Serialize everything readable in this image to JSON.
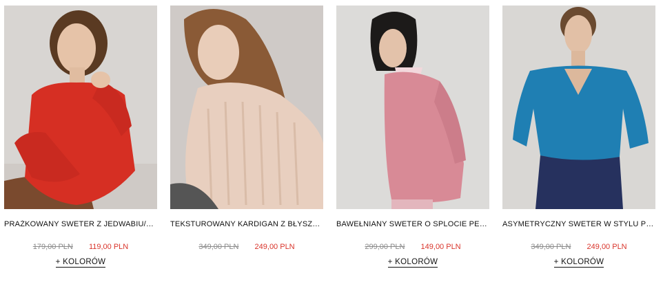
{
  "products": [
    {
      "name": "PRAŻKOWANY SWETER Z JEDWABIU/WEŁNĄ",
      "old_price": "179,00 PLN",
      "new_price": "119,00 PLN",
      "colors_link": "+ KOLORÓW",
      "sweater_color": "#d62f23",
      "image_alt": "Model in red ribbed sweater"
    },
    {
      "name": "TEKSTUROWANY KARDIGAN Z BŁYSZCZĄCĄ NICIĄ",
      "old_price": "349,00 PLN",
      "new_price": "249,00 PLN",
      "colors_link": "",
      "sweater_color": "#e8cfbf",
      "image_alt": "Model in beige textured cardigan"
    },
    {
      "name": "BAWEŁNIANY SWETER O SPLOCIE PERŁOWYM",
      "old_price": "299,00 PLN",
      "new_price": "149,00 PLN",
      "colors_link": "+ KOLORÓW",
      "sweater_color": "#d88a96",
      "image_alt": "Model in pink cotton sweater"
    },
    {
      "name": "ASYMETRYCZNY SWETER W STYLU PELERYNY",
      "old_price": "349,00 PLN",
      "new_price": "249,00 PLN",
      "colors_link": "+ KOLORÓW",
      "sweater_color": "#1f7fb3",
      "image_alt": "Model in blue v-neck sweater"
    }
  ]
}
